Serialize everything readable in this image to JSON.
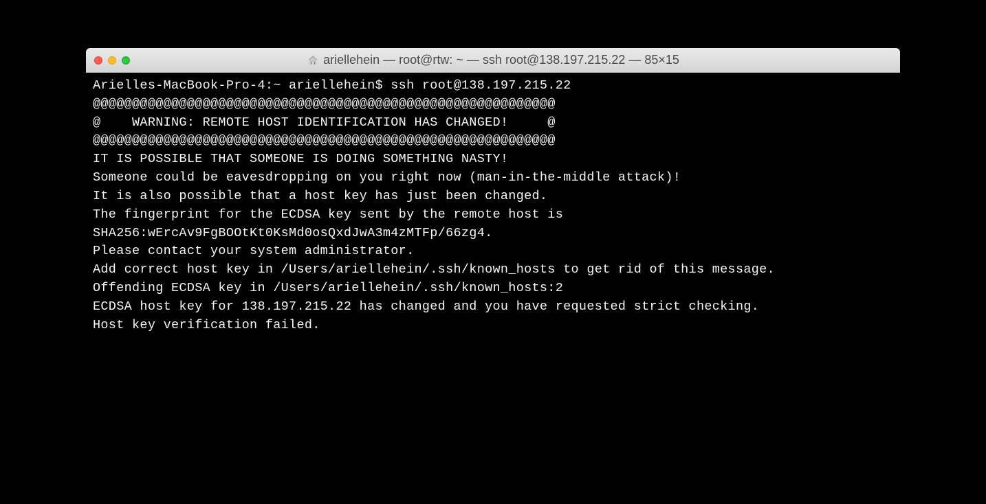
{
  "window": {
    "title": "ariellehein — root@rtw: ~ — ssh root@138.197.215.22 — 85×15"
  },
  "terminal": {
    "prompt_host": "Arielles-MacBook-Pro-4:~ ariellehein$ ",
    "command": "ssh root@138.197.215.22",
    "lines": [
      "@@@@@@@@@@@@@@@@@@@@@@@@@@@@@@@@@@@@@@@@@@@@@@@@@@@@@@@@@@@",
      "@    WARNING: REMOTE HOST IDENTIFICATION HAS CHANGED!     @",
      "@@@@@@@@@@@@@@@@@@@@@@@@@@@@@@@@@@@@@@@@@@@@@@@@@@@@@@@@@@@",
      "IT IS POSSIBLE THAT SOMEONE IS DOING SOMETHING NASTY!",
      "Someone could be eavesdropping on you right now (man-in-the-middle attack)!",
      "It is also possible that a host key has just been changed.",
      "The fingerprint for the ECDSA key sent by the remote host is",
      "SHA256:wErcAv9FgBOOtKt0KsMd0osQxdJwA3m4zMTFp/66zg4.",
      "Please contact your system administrator.",
      "Add correct host key in /Users/ariellehein/.ssh/known_hosts to get rid of this message.",
      "Offending ECDSA key in /Users/ariellehein/.ssh/known_hosts:2",
      "ECDSA host key for 138.197.215.22 has changed and you have requested strict checking.",
      "Host key verification failed."
    ]
  }
}
